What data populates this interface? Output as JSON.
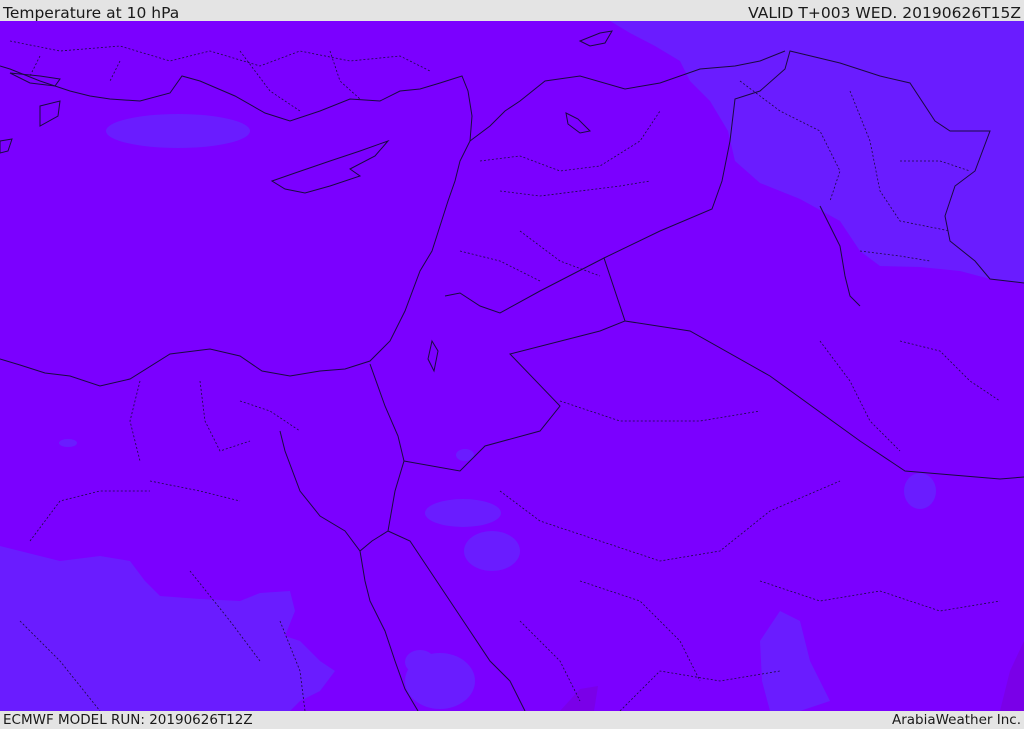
{
  "header": {
    "title": "Temperature at 10 hPa",
    "valid": "VALID T+003 WED. 20190626T15Z"
  },
  "footer": {
    "model_run": "ECMWF MODEL RUN: 20190626T12Z",
    "credit": "ArabiaWeather Inc."
  },
  "map": {
    "field": "temperature",
    "level_hpa": 10,
    "colors": {
      "base_fill": "#7b00ff",
      "cooler_fill": "#6a1cff",
      "warmer_fill": "#7a00e8",
      "boundary_line": "#1a0a40"
    }
  }
}
